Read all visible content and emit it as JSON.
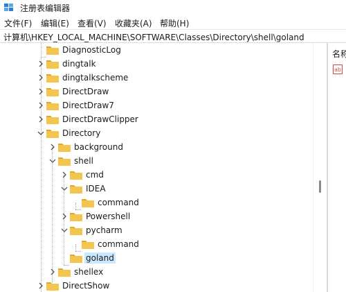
{
  "window": {
    "title": "注册表编辑器"
  },
  "menu": [
    {
      "label": "文件(F)"
    },
    {
      "label": "编辑(E)"
    },
    {
      "label": "查看(V)"
    },
    {
      "label": "收藏夹(A)"
    },
    {
      "label": "帮助(H)"
    }
  ],
  "address": {
    "path": "计算机\\HKEY_LOCAL_MACHINE\\SOFTWARE\\Classes\\Directory\\shell\\goland"
  },
  "tree": [
    {
      "label": "DiagnosticLog",
      "chevron": "none",
      "selected": false
    },
    {
      "label": "dingtalk",
      "chevron": "right",
      "selected": false
    },
    {
      "label": "dingtalkscheme",
      "chevron": "right",
      "selected": false
    },
    {
      "label": "DirectDraw",
      "chevron": "right",
      "selected": false
    },
    {
      "label": "DirectDraw7",
      "chevron": "right",
      "selected": false
    },
    {
      "label": "DirectDrawClipper",
      "chevron": "right",
      "selected": false
    },
    {
      "label": "Directory",
      "chevron": "down",
      "selected": false
    },
    {
      "label": "background",
      "chevron": "right",
      "selected": false
    },
    {
      "label": "shell",
      "chevron": "down",
      "selected": false
    },
    {
      "label": "cmd",
      "chevron": "right",
      "selected": false
    },
    {
      "label": "IDEA",
      "chevron": "down",
      "selected": false
    },
    {
      "label": "command",
      "chevron": "none",
      "selected": false
    },
    {
      "label": "Powershell",
      "chevron": "right",
      "selected": false
    },
    {
      "label": "pycharm",
      "chevron": "down",
      "selected": false
    },
    {
      "label": "command",
      "chevron": "none",
      "selected": false
    },
    {
      "label": "goland",
      "chevron": "none",
      "selected": true
    },
    {
      "label": "shellex",
      "chevron": "right",
      "selected": false
    },
    {
      "label": "DirectShow",
      "chevron": "right",
      "selected": false
    }
  ],
  "right_pane": {
    "header": "名称"
  },
  "colors": {
    "folder": "#f3c54f",
    "folder_dark": "#e0a72b",
    "selection": "#cce8ff"
  }
}
